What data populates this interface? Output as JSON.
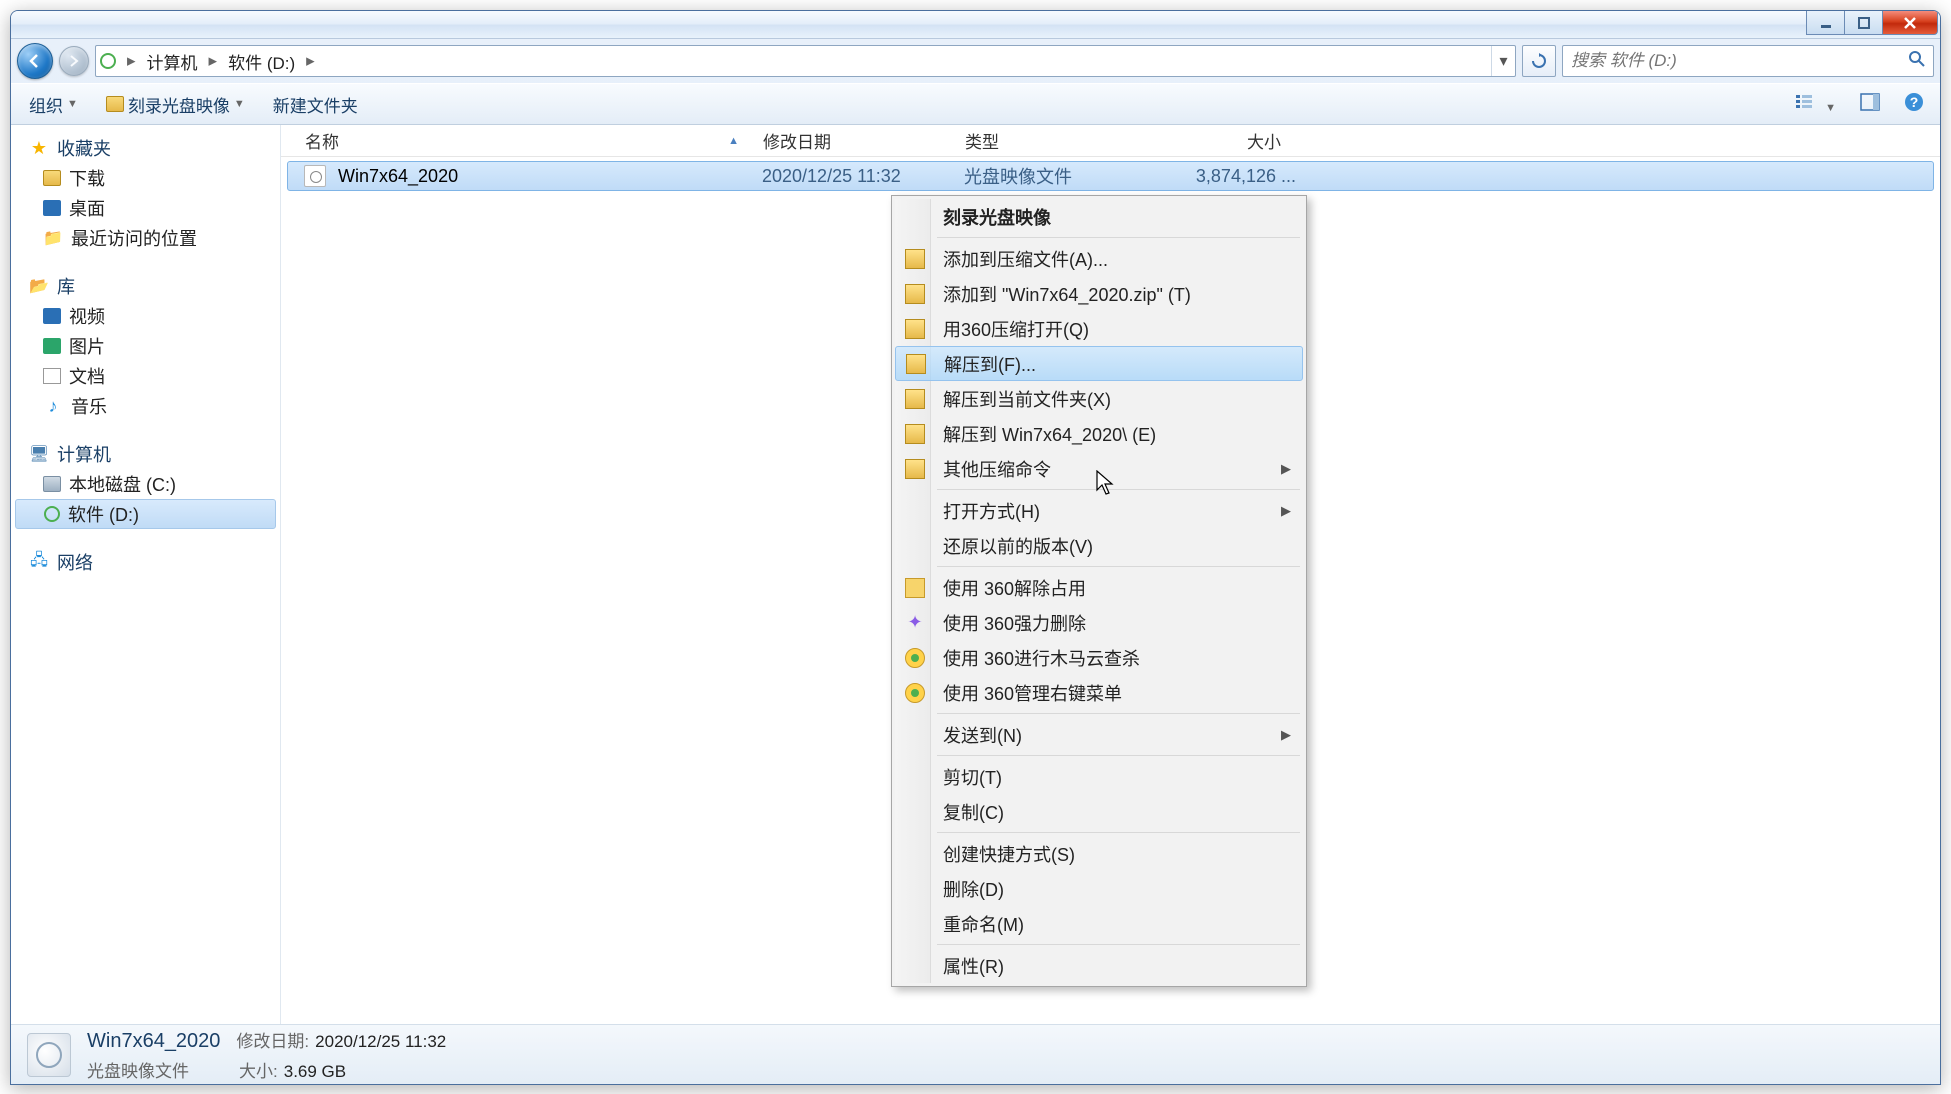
{
  "breadcrumbs": {
    "computer": "计算机",
    "drive": "软件 (D:)"
  },
  "search": {
    "placeholder": "搜索 软件 (D:)"
  },
  "toolbar": {
    "organize": "组织",
    "burn": "刻录光盘映像",
    "newfolder": "新建文件夹"
  },
  "columns": {
    "name": "名称",
    "date": "修改日期",
    "type": "类型",
    "size": "大小"
  },
  "file": {
    "name": "Win7x64_2020",
    "date": "2020/12/25 11:32",
    "type": "光盘映像文件",
    "size": "3,874,126 ..."
  },
  "sidebar": {
    "favorites": "收藏夹",
    "downloads": "下载",
    "desktop": "桌面",
    "recent": "最近访问的位置",
    "libraries": "库",
    "videos": "视频",
    "pictures": "图片",
    "documents": "文档",
    "music": "音乐",
    "computer": "计算机",
    "localdisk": "本地磁盘 (C:)",
    "software": "软件 (D:)",
    "network": "网络"
  },
  "context": {
    "burn": "刻录光盘映像",
    "add_archive": "添加到压缩文件(A)...",
    "add_zip": "添加到 \"Win7x64_2020.zip\" (T)",
    "open_360zip": "用360压缩打开(Q)",
    "extract_to": "解压到(F)...",
    "extract_here": "解压到当前文件夹(X)",
    "extract_named": "解压到 Win7x64_2020\\ (E)",
    "other_zip": "其他压缩命令",
    "open_with": "打开方式(H)",
    "restore_prev": "还原以前的版本(V)",
    "use_360_lock": "使用 360解除占用",
    "use_360_delete": "使用 360强力删除",
    "use_360_scan": "使用 360进行木马云查杀",
    "use_360_menu": "使用 360管理右键菜单",
    "send_to": "发送到(N)",
    "cut": "剪切(T)",
    "copy": "复制(C)",
    "shortcut": "创建快捷方式(S)",
    "delete": "删除(D)",
    "rename": "重命名(M)",
    "properties": "属性(R)"
  },
  "status": {
    "title": "Win7x64_2020",
    "mod_label": "修改日期:",
    "mod_val": "2020/12/25 11:32",
    "type": "光盘映像文件",
    "size_label": "大小:",
    "size_val": "3.69 GB"
  }
}
